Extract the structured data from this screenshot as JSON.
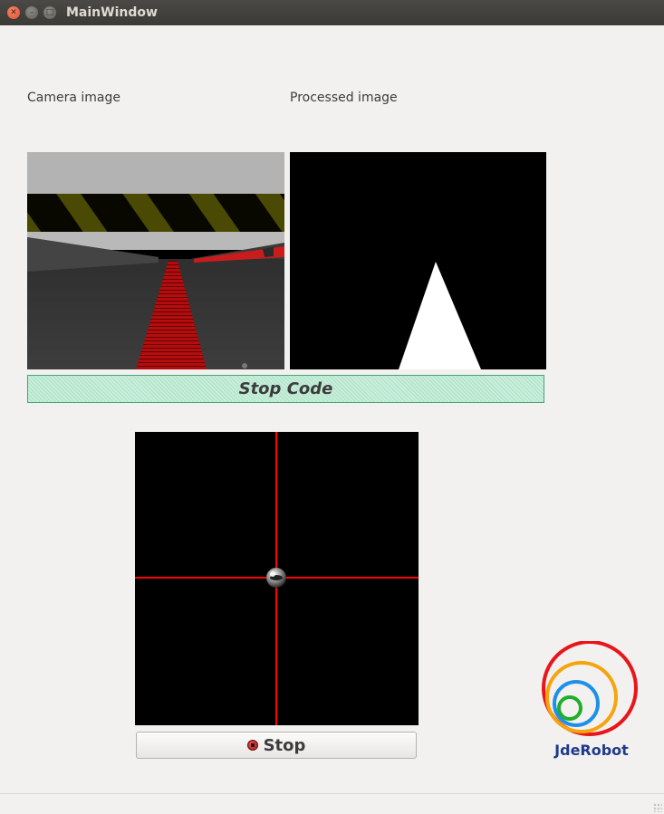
{
  "window": {
    "title": "MainWindow"
  },
  "labels": {
    "camera": "Camera image",
    "processed": "Processed image"
  },
  "buttons": {
    "stop_code": "Stop Code",
    "stop": "Stop"
  },
  "logo": {
    "text": "JdeRobot"
  },
  "colors": {
    "accent_green": "#aee3c6",
    "crosshair_red": "#ff0000",
    "logo_red": "#e8161a",
    "logo_orange": "#f5a40c",
    "logo_blue": "#1e90e8",
    "logo_green": "#1fae2b",
    "logo_text": "#1f3a8a"
  }
}
